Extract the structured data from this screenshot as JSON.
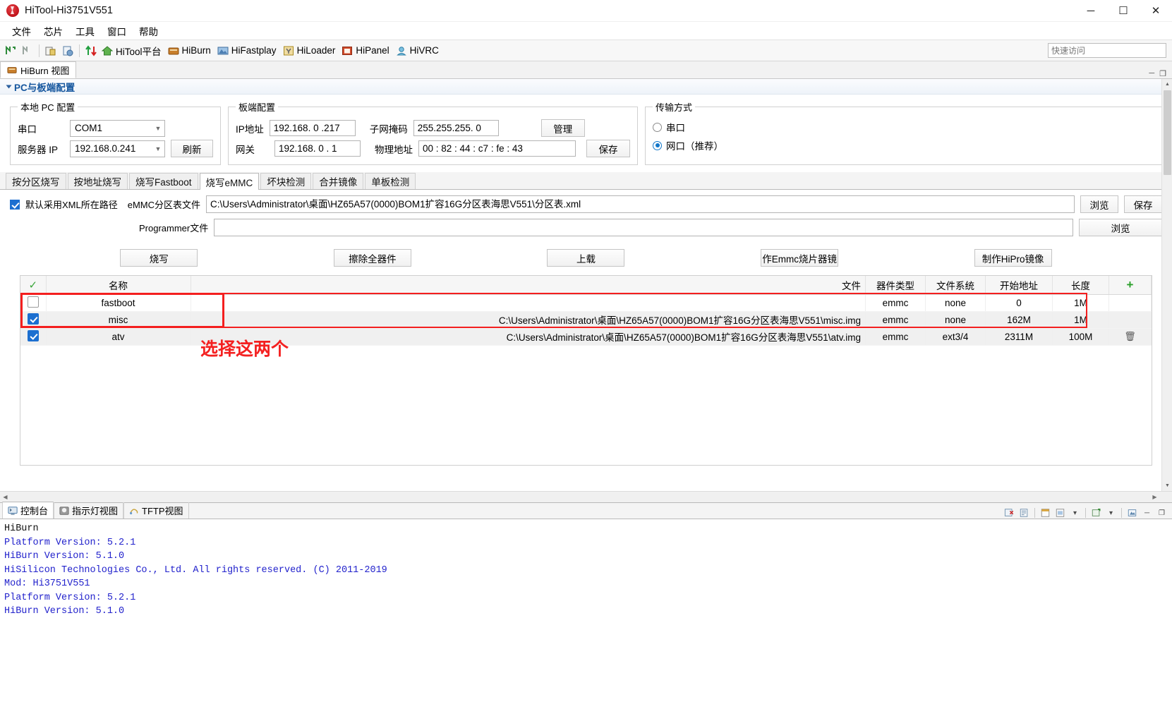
{
  "window": {
    "title": "HiTool-Hi3751V551",
    "icon": "app-logo-icon",
    "minimize": "─",
    "maximize": "☐",
    "close": "✕"
  },
  "menubar": [
    {
      "label": "文件"
    },
    {
      "label": "芯片"
    },
    {
      "label": "工具"
    },
    {
      "label": "窗口"
    },
    {
      "label": "帮助"
    }
  ],
  "toolbar": {
    "buttons": [
      {
        "label": "HiTool平台",
        "icon": "home-icon",
        "color": "#4a9a3f"
      },
      {
        "label": "HiBurn",
        "icon": "hiburn-icon",
        "color": "#b86a1e"
      },
      {
        "label": "HiFastplay",
        "icon": "hifastplay-icon",
        "color": "#3d6ea8"
      },
      {
        "label": "HiLoader",
        "icon": "hiloader-icon",
        "color": "#c8a33a"
      },
      {
        "label": "HiPanel",
        "icon": "hipanel-icon",
        "color": "#c4452b"
      },
      {
        "label": "HiVRC",
        "icon": "hivrc-icon",
        "color": "#4f9bc4"
      }
    ],
    "quick_access_placeholder": "快速访问"
  },
  "view_tab": {
    "label": "HiBurn 视图",
    "icon": "hiburn-icon",
    "minimize": "─",
    "maximize": "❐"
  },
  "section": {
    "title": "PC与板端配置",
    "collapsed": false
  },
  "local_pc": {
    "legend": "本地 PC 配置",
    "serial_label": "串口",
    "serial_value": "COM1",
    "server_ip_label": "服务器 IP",
    "server_ip_value": "192.168.0.241",
    "refresh_label": "刷新"
  },
  "board": {
    "legend": "板端配置",
    "ip_label": "IP地址",
    "ip_value": "192.168. 0 .217",
    "gateway_label": "网关",
    "gateway_value": "192.168. 0 . 1",
    "mask_label": "子网掩码",
    "mask_value": "255.255.255. 0",
    "mac_label": "物理地址",
    "mac_value": "00 : 82 : 44 : c7 : fe : 43",
    "manage_label": "管理",
    "save_label": "保存"
  },
  "transfer": {
    "legend": "传输方式",
    "options": [
      {
        "label": "串口",
        "selected": false
      },
      {
        "label": "网口（推荐）",
        "selected": true
      }
    ]
  },
  "tabs": [
    {
      "label": "按分区烧写",
      "active": false
    },
    {
      "label": "按地址烧写",
      "active": false
    },
    {
      "label": "烧写Fastboot",
      "active": false
    },
    {
      "label": "烧写eMMC",
      "active": true
    },
    {
      "label": "坏块检测",
      "active": false
    },
    {
      "label": "合并镜像",
      "active": false
    },
    {
      "label": "单板检测",
      "active": false
    }
  ],
  "emmc": {
    "default_xml_path_label": "默认采用XML所在路径",
    "default_xml_path_checked": true,
    "partition_file_label": "eMMC分区表文件",
    "partition_file_value": "C:\\Users\\Administrator\\桌面\\HZ65A57(0000)BOM1扩容16G分区表海思V551\\分区表.xml",
    "browse_label": "浏览",
    "save_label": "保存",
    "programmer_label": "Programmer文件",
    "programmer_value": "",
    "programmer_browse_label": "浏览",
    "actions": [
      {
        "label": "烧写"
      },
      {
        "label": "擦除全器件"
      },
      {
        "label": "上载"
      },
      {
        "label": "作Emmc烧片器镜"
      },
      {
        "label": "制作HiPro镜像"
      }
    ]
  },
  "table": {
    "headers": {
      "check": "✓",
      "name": "名称",
      "file": "文件",
      "device": "器件类型",
      "fs": "文件系统",
      "start": "开始地址",
      "length": "长度",
      "add": "+"
    },
    "rows": [
      {
        "checked": false,
        "name": "fastboot",
        "file": "",
        "device": "emmc",
        "fs": "none",
        "start": "0",
        "length": "1M",
        "delete": ""
      },
      {
        "checked": true,
        "name": "misc",
        "file": "C:\\Users\\Administrator\\桌面\\HZ65A57(0000)BOM1扩容16G分区表海思V551\\misc.img",
        "device": "emmc",
        "fs": "none",
        "start": "162M",
        "length": "1M",
        "delete": ""
      },
      {
        "checked": true,
        "name": "atv",
        "file": "C:\\Users\\Administrator\\桌面\\HZ65A57(0000)BOM1扩容16G分区表海思V551\\atv.img",
        "device": "emmc",
        "fs": "ext3/4",
        "start": "2311M",
        "length": "100M",
        "delete": "🗑"
      }
    ]
  },
  "annotation": {
    "text": "选择这两个",
    "color": "#f42020"
  },
  "console": {
    "tabs": [
      {
        "label": "控制台",
        "icon": "console-icon",
        "active": true
      },
      {
        "label": "指示灯视图",
        "icon": "indicator-icon",
        "active": false
      },
      {
        "label": "TFTP视图",
        "icon": "tftp-icon",
        "active": false
      }
    ],
    "tools": [
      {
        "icon": "clear-console-icon"
      },
      {
        "icon": "scroll-lock-icon"
      },
      {
        "icon": "pin-console-icon"
      },
      {
        "icon": "display-selected-icon"
      },
      {
        "icon": "chevron-down-icon"
      },
      {
        "icon": "open-console-icon"
      },
      {
        "icon": "chevron-down-2-icon"
      },
      {
        "icon": "export-icon"
      },
      {
        "icon": "minimize-icon"
      },
      {
        "icon": "maximize-icon"
      }
    ],
    "lines": [
      {
        "text": "HiBurn",
        "color": "black"
      },
      {
        "text": "",
        "color": "black"
      },
      {
        "text": "",
        "color": "black"
      },
      {
        "text": "Platform Version: 5.2.1",
        "color": "blue"
      },
      {
        "text": "HiBurn Version: 5.1.0",
        "color": "blue"
      },
      {
        "text": "HiSilicon Technologies Co., Ltd. All rights reserved. (C) 2011-2019",
        "color": "blue"
      },
      {
        "text": "Mod: Hi3751V551",
        "color": "blue"
      },
      {
        "text": "",
        "color": "blue"
      },
      {
        "text": "",
        "color": "blue"
      },
      {
        "text": "Platform Version: 5.2.1",
        "color": "blue"
      },
      {
        "text": "HiBurn Version: 5.1.0",
        "color": "blue"
      }
    ]
  }
}
